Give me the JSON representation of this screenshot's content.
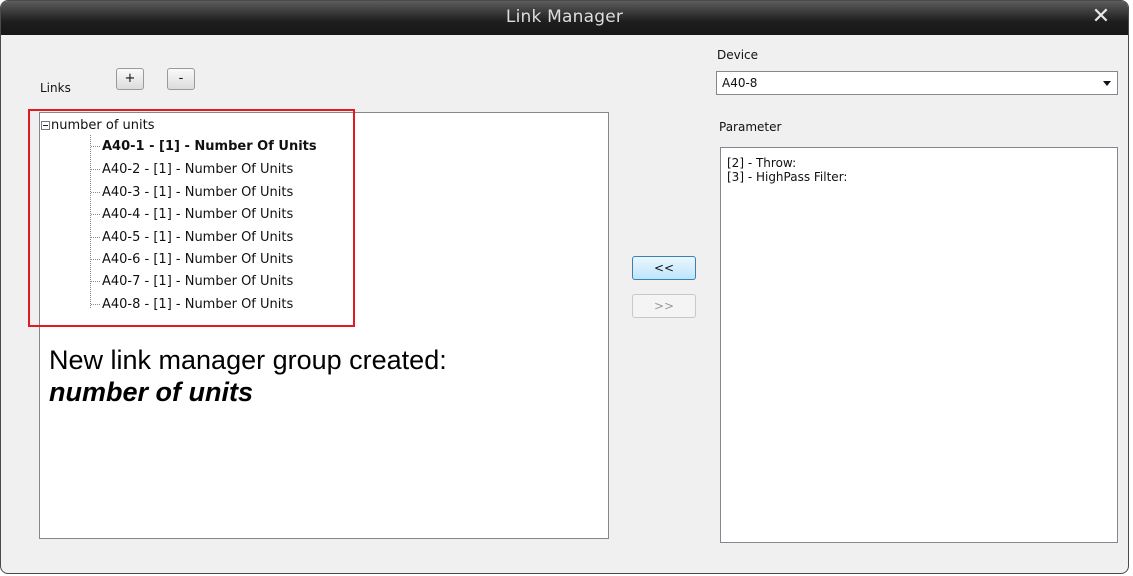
{
  "window": {
    "title": "Link Manager"
  },
  "links": {
    "label": "Links",
    "add_label": "+",
    "remove_label": "-",
    "tree": {
      "root": "number of units",
      "items": [
        "A40-1 - [1] - Number Of Units",
        "A40-2 - [1] - Number Of Units",
        "A40-3 - [1] - Number Of Units",
        "A40-4 - [1] - Number Of Units",
        "A40-5 - [1] - Number Of Units",
        "A40-6 - [1] - Number Of Units",
        "A40-7 - [1] - Number Of Units",
        "A40-8 - [1] - Number Of Units"
      ]
    }
  },
  "annotation": {
    "line1": "New link manager group created:",
    "line2": "number of units"
  },
  "buttons": {
    "move_left": "<<",
    "move_right": ">>"
  },
  "device": {
    "label": "Device",
    "selected": "A40-8"
  },
  "parameter": {
    "label": "Parameter",
    "items": [
      "[2] - Throw:",
      "[3] - HighPass Filter:"
    ]
  },
  "colors": {
    "highlight": "#e01b22",
    "title_bar": "#1e1e1e"
  }
}
